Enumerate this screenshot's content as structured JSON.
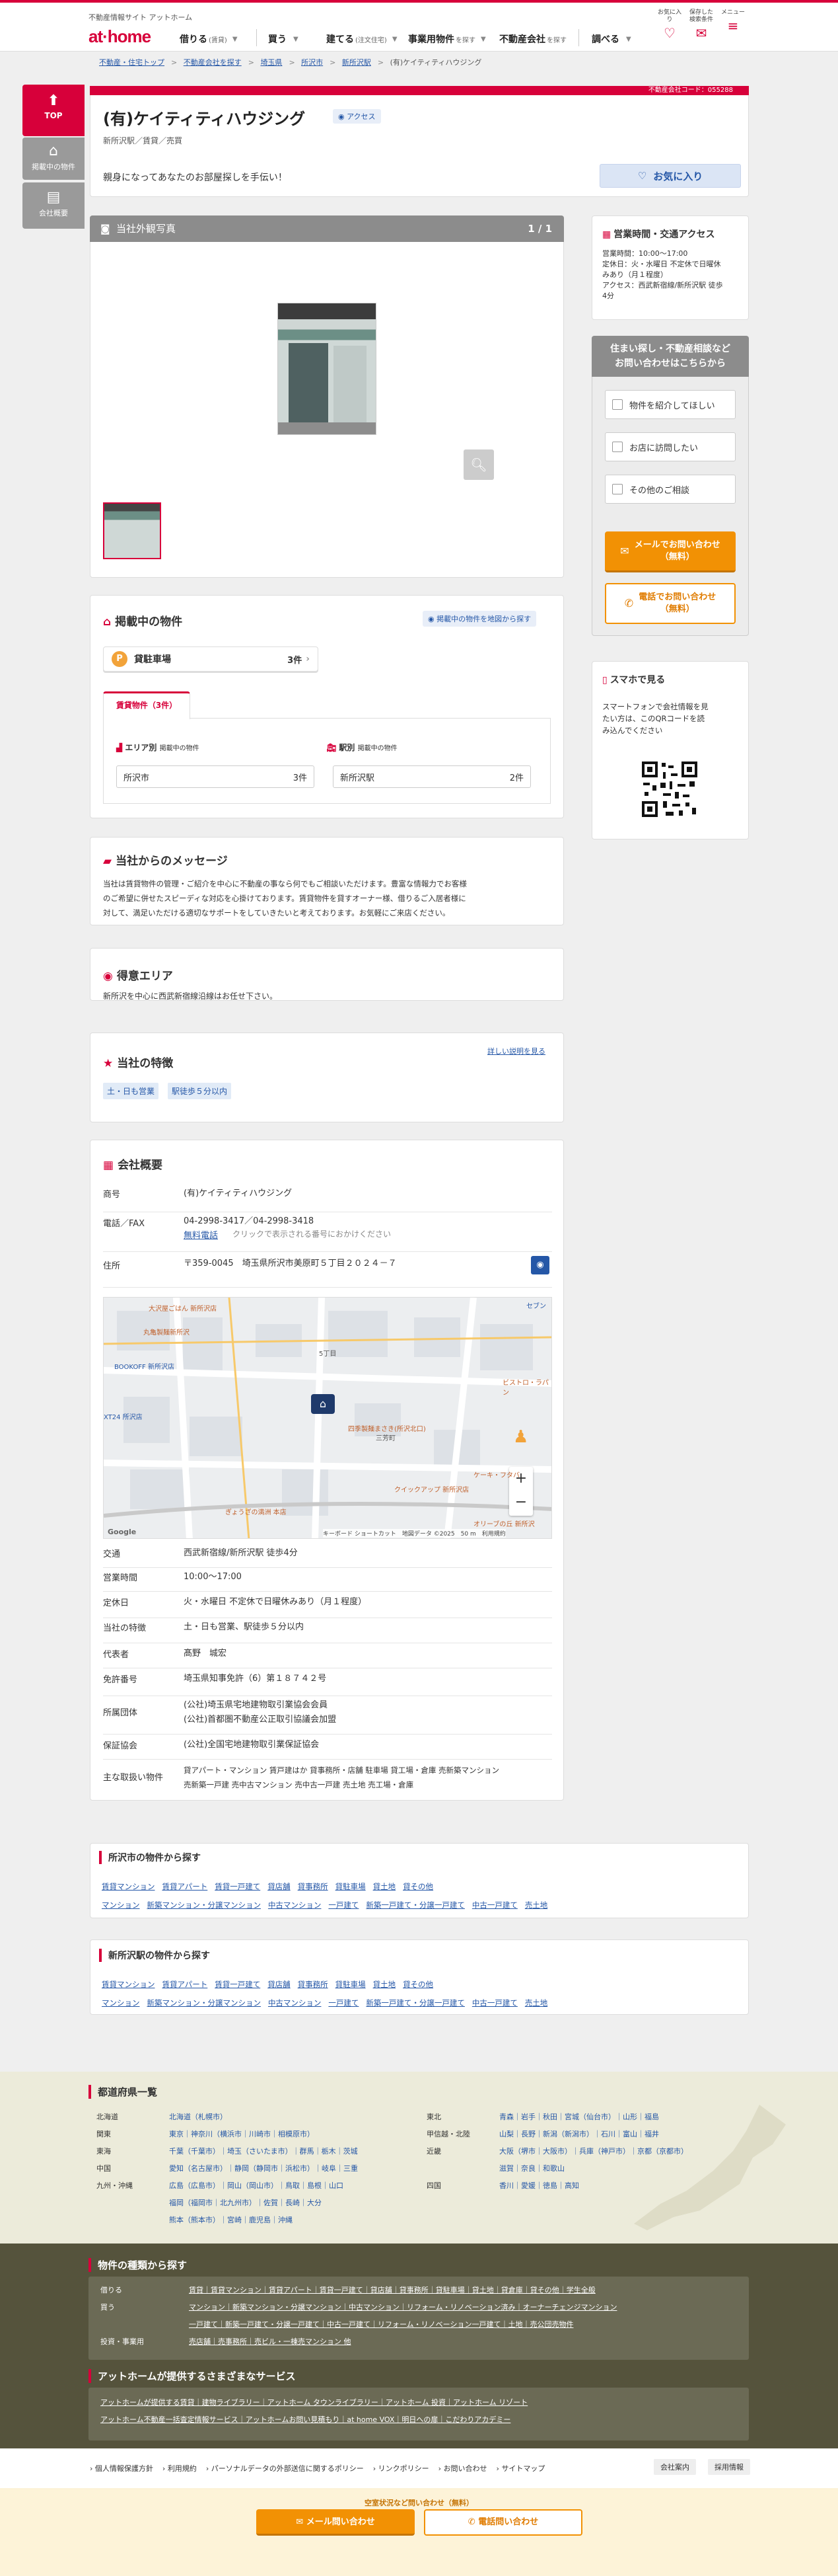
{
  "header": {
    "tagline": "不動産情報サイト アットホーム",
    "logo_a": "at",
    "logo_b": "home",
    "nav": [
      {
        "label": "借りる",
        "sub": "(賃貸)"
      },
      {
        "label": "買う",
        "sub": ""
      },
      {
        "label": "建てる",
        "sub": "(注文住宅)"
      },
      {
        "label": "事業用物件",
        "sub": "を探す"
      },
      {
        "label": "不動産会社",
        "sub": "を探す"
      },
      {
        "label": "調べる",
        "sub": ""
      }
    ],
    "icons": [
      {
        "label": "お気に入り",
        "icon": "heart-icon"
      },
      {
        "label": "保存した検索条件",
        "icon": "mail-icon"
      },
      {
        "label": "メニュー",
        "icon": "menu-icon"
      }
    ]
  },
  "breadcrumb": [
    "不動産・住宅トップ",
    "不動産会社を探す",
    "埼玉県",
    "所沢市",
    "新所沢駅",
    "(有)ケイティティハウジング"
  ],
  "side_tabs": [
    "TOP",
    "掲載中の物件",
    "会社概要"
  ],
  "company": {
    "code_label": "不動産会社コード：055288",
    "name": "(有)ケイティティハウジング",
    "access_badge": "アクセス",
    "sub": "新所沢駅／賃貸／売買",
    "catch": "親身になってあなたのお部屋探しを手伝い！",
    "fav_label": "お気に入り"
  },
  "photo": {
    "title": "当社外観写真",
    "count": "1 / 1"
  },
  "listing": {
    "title": "掲載中の物件",
    "map_btn": "掲載中の物件を地図から探す",
    "category": "貸駐車場",
    "category_count": "3件",
    "tab": "賃貸物件（3件）",
    "area_head": "エリア別",
    "area_head_sub": "掲載中の物件",
    "area_name": "所沢市",
    "area_count": "3件",
    "station_head": "駅別",
    "station_head_sub": "掲載中の物件",
    "station_name": "新所沢駅",
    "station_count": "2件"
  },
  "message": {
    "title": "当社からのメッセージ",
    "body1": "当社は賃貸物件の管理・ご紹介を中心に不動産の事なら何でもご相談いただけます。豊富な情報力でお客様",
    "body2": "のご希望に併せたスピーディな対応を心掛けております。賃貸物件を貸すオーナー様、借りるご入居者様に",
    "body3": "対して、満足いただける適切なサポートをしていきたいと考えております。お気軽にご来店ください。"
  },
  "area": {
    "title": "得意エリア",
    "body": "新所沢を中心に西武新宿線沿線はお任せ下さい。"
  },
  "features": {
    "title": "当社の特徴",
    "link": "詳しい説明を見る",
    "tags": [
      "土・日も営業",
      "駅徒歩５分以内"
    ]
  },
  "overview": {
    "title": "会社概要",
    "rows": [
      {
        "k": "商号",
        "v": "(有)ケイティティハウジング"
      },
      {
        "k": "電話／FAX",
        "v": "04-2998-3417／04-2998-3418",
        "link": "無料電話",
        "note": "クリックで表示される番号におかけください"
      },
      {
        "k": "住所",
        "v": "〒359-0045　埼玉県所沢市美原町５丁目２０２４－７"
      },
      {
        "k": "交通",
        "v": "西武新宿線/新所沢駅 徒歩4分"
      },
      {
        "k": "営業時間",
        "v": "10:00～17:00"
      },
      {
        "k": "定休日",
        "v": "火・水曜日 不定休で日曜休みあり（月１程度）"
      },
      {
        "k": "当社の特徴",
        "v": "土・日も営業、駅徒歩５分以内"
      },
      {
        "k": "代表者",
        "v": "髙野　城宏"
      },
      {
        "k": "免許番号",
        "v": "埼玉県知事免許（6）第１８７４２号"
      },
      {
        "k": "所属団体",
        "v": "(公社)埼玉県宅地建物取引業協会会員",
        "v2": "(公社)首都圏不動産公正取引協議会加盟"
      },
      {
        "k": "保証協会",
        "v": "(公社)全国宅地建物取引業保証協会"
      },
      {
        "k": "主な取扱い物件",
        "v": "貸アパート・マンション 賃戸建はか 貸事務所・店舗 駐車場 貸工場・倉庫 売新築マンション",
        "v2": "売新築一戸建 売中古マンション 売中古一戸建 売土地 売工場・倉庫"
      }
    ],
    "map": {
      "labels": [
        "大沢屋ごはん 新所沢店",
        "丸亀製麺新所沢",
        "BOOKOFF 新所沢店",
        "XT24 所沢店",
        "ビストロ・ラパン",
        "三芳町",
        "四季製麺まさき(所沢北口)",
        "ケーキ・フタバ",
        "クイックアップ 新所沢店",
        "ぎょうざの満洲 本店",
        "オリーブの丘 新所沢",
        "セブン",
        "5丁目"
      ],
      "footer": "キーボード ショートカット　地図データ ©2025　50 m　利用規約",
      "google": "Google"
    }
  },
  "right": {
    "hours_title": "営業時間・交通アクセス",
    "hours": [
      "営業時間：10:00～17:00",
      "定休日：火・水曜日 不定休で日曜休",
      "みあり（月１程度）",
      "アクセス：西武新宿線/新所沢駅 徒歩",
      "4分"
    ],
    "inquiry_title1": "住まい探し・不動産相談など",
    "inquiry_title2": "お問い合わせはこちらから",
    "checks": [
      "物件を紹介してほしい",
      "お店に訪問したい",
      "その他のご相談"
    ],
    "mail_btn1": "メールでお問い合わせ",
    "mail_btn2": "（無料）",
    "tel_btn1": "電話でお問い合わせ",
    "tel_btn2": "（無料）",
    "phone_title": "スマホで見る",
    "phone_body": [
      "スマートフォンで会社情報を見",
      "たい方は、このQRコードを読",
      "み込んでください"
    ]
  },
  "city_search": {
    "title": "所沢市の物件から探す",
    "row1": [
      "賃貸マンション",
      "賃貸アパート",
      "賃貸一戸建て",
      "貸店舗",
      "貸事務所",
      "貸駐車場",
      "貸土地",
      "貸その他"
    ],
    "row2": [
      "マンション",
      "新築マンション・分譲マンション",
      "中古マンション",
      "一戸建て",
      "新築一戸建て・分譲一戸建て",
      "中古一戸建て",
      "売土地"
    ]
  },
  "station_search": {
    "title": "新所沢駅の物件から探す",
    "row1": [
      "賃貸マンション",
      "賃貸アパート",
      "賃貸一戸建て",
      "貸店舗",
      "貸事務所",
      "貸駐車場",
      "貸土地",
      "貸その他"
    ],
    "row2": [
      "マンション",
      "新築マンション・分譲マンション",
      "中古マンション",
      "一戸建て",
      "新築一戸建て・分譲一戸建て",
      "中古一戸建て",
      "売土地"
    ]
  },
  "prefectures": {
    "title": "都道府県一覧",
    "left": [
      {
        "r": "北海道",
        "p": "北海道（札幌市）"
      },
      {
        "r": "関東",
        "p": "東京｜神奈川（横浜市｜川崎市｜相模原市）"
      },
      {
        "r": "",
        "p": "千葉（千葉市）｜埼玉（さいたま市）｜群馬｜栃木｜茨城"
      },
      {
        "r": "東海",
        "p": "愛知（名古屋市）｜静岡（静岡市｜浜松市）｜岐阜｜三重"
      },
      {
        "r": "中国",
        "p": "広島（広島市）｜岡山（岡山市）｜鳥取｜島根｜山口"
      },
      {
        "r": "九州・沖縄",
        "p": "福岡（福岡市｜北九州市）｜佐賀｜長崎｜大分"
      },
      {
        "r": "",
        "p": "熊本（熊本市）｜宮崎｜鹿児島｜沖縄"
      }
    ],
    "right": [
      {
        "r": "東北",
        "p": "青森｜岩手｜秋田｜宮城（仙台市）｜山形｜福島"
      },
      {
        "r": "甲信越・北陸",
        "p": "山梨｜長野｜新潟（新潟市）｜石川｜富山｜福井"
      },
      {
        "r": "近畿",
        "p": "大阪（堺市｜大阪市）｜兵庫（神戸市）｜京都（京都市）"
      },
      {
        "r": "",
        "p": "滋賀｜奈良｜和歌山"
      },
      {
        "r": "四国",
        "p": "香川｜愛媛｜徳島｜高知"
      }
    ]
  },
  "property_types": {
    "title": "物件の種類から探す",
    "rows": [
      {
        "k": "借りる",
        "v": "賃貸｜賃貸マンション｜賃貸アパート｜賃貸一戸建て｜貸店舗｜貸事務所｜貸駐車場｜貸土地｜貸倉庫｜貸その他｜学生全般"
      },
      {
        "k": "買う",
        "v": "マンション｜新築マンション・分譲マンション｜中古マンション｜リフォーム・リノベーション済み｜オーナーチェンジマンション"
      },
      {
        "k": "",
        "v": "一戸建て｜新築一戸建て・分譲一戸建て｜中古一戸建て｜リフォーム・リノベーション一戸建て｜土地｜売公団売物件"
      },
      {
        "k": "投資・事業用",
        "v": "売店舗｜売事務所｜売ビル・一棟売マンション 他"
      }
    ],
    "service_title": "アットホームが提供するさまざまなサービス",
    "services": [
      "アットホームが提供する賃貸｜建物ライブラリー｜アットホーム タウンライブラリー｜アットホーム 投資｜アットホーム リゾート",
      "アットホーム不動産一括査定情報サービス｜アットホームお問い見積もり｜at home VOX｜明日への扉｜こだわりアカデミー"
    ]
  },
  "footer_links": [
    "個人情報保護方針",
    "利用規約",
    "パーソナルデータの外部送信に関するポリシー",
    "リンクポリシー",
    "お問い合わせ",
    "サイトマップ"
  ],
  "footer_btns": [
    "会社案内",
    "採用情報"
  ],
  "bottom_bar": {
    "note": "空室状況など問い合わせ（無料）",
    "mail": "メール問い合わせ",
    "tel": "電話問い合わせ"
  },
  "colors": {
    "brand": "#d7003a",
    "link": "#2557a7",
    "orange": "#f29104"
  }
}
